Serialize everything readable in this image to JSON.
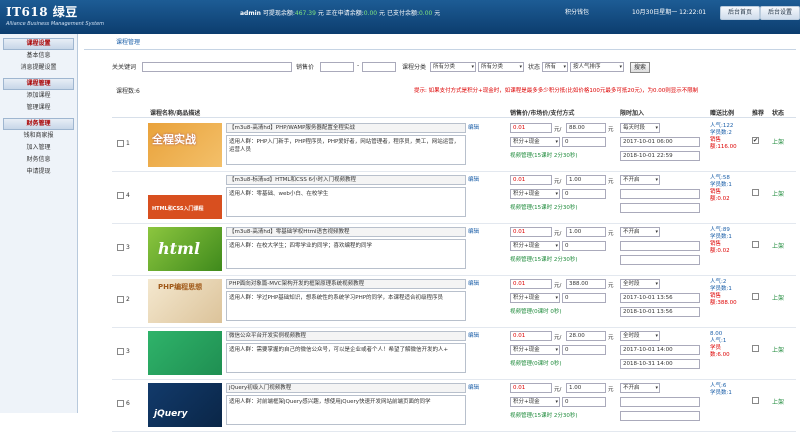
{
  "header": {
    "logo": "IT618 绿豆",
    "logo_sub": "Alliance Business Management System",
    "admin": "admin",
    "s1": "可提现余额:",
    "v1": "467.39",
    "s2": "元 正在申请余额:",
    "v2": "0.00",
    "s3": "元 已支付余额:",
    "v3": "0.00",
    "s4": "元",
    "link1": "积分钱包",
    "date": "10月30日星期一 12:22:01",
    "buttons": [
      "后台首页",
      "后台设置",
      "后台帮助",
      "退出"
    ]
  },
  "sidebar": {
    "sections": [
      {
        "title": "课程设置",
        "items": [
          "基本信息",
          "消息提醒设置"
        ]
      },
      {
        "title": "课程管理",
        "items": [
          "添加课程",
          "管理课程"
        ]
      },
      {
        "title": "财务管理",
        "items": [
          "钱和商家报",
          "加入管理",
          "财务信息",
          "申请提现"
        ]
      }
    ]
  },
  "main": {
    "crumb": "课程管理",
    "filter": {
      "kw_label": "关关键词",
      "price_label": "销售价",
      "dash": "-",
      "cat_label": "课程分类",
      "cat1": "所有分类",
      "cat2": "所有分类",
      "state_label": "状态",
      "state": "所有",
      "sort": "按人气排序",
      "btn": "搜索"
    },
    "count": "课程数:6",
    "tip": "提示: 如果支付方式是积分+现金时，如课程是最多多少积分抵(比如价格100元最多可抵20元)，为0.00则显示不限制",
    "headers": [
      "课程名称/商品描述",
      "销售价/市场价/支付方式",
      "限时加入",
      "赠送比例",
      "推荐",
      "状态"
    ],
    "rows": [
      {
        "num": "1",
        "thumb": "全程实战",
        "title": "【m3u8-高清hd】PHP/WAMP服务器配置全程实战",
        "desc": "适用人群：PHP入门新手，PHP程序员，PHP爱好者，网站管理者，程序员，美工，网站运营，运营人员",
        "edit": "编辑",
        "price": "0.01",
        "mkt": "88.00",
        "pay": "积分+现金",
        "paynum": "0",
        "note": "视频管理(15课时 2分30秒)",
        "lt": "每天时段",
        "d1": "2017-10-01 06:00",
        "d2": "2018-10-01 22:59",
        "r1": "人气:122",
        "r2": "学员数:2",
        "r3": "销售额:116.00",
        "rec": "✔",
        "status": "上架"
      },
      {
        "num": "4",
        "thumb": "HTML和CSS入门课程",
        "title": "【m3u8-标清sd】HTML和CSS 6小时入门视频教程",
        "desc": "适用人群：零基础、web小白、在校学生",
        "edit": "编辑",
        "price": "0.01",
        "mkt": "1.00",
        "pay": "积分+现金",
        "paynum": "0",
        "note": "视频管理(15课时 2分30秒)",
        "lt": "不开启",
        "d1": "",
        "d2": "",
        "r1": "人气:58",
        "r2": "学员数:1",
        "r3": "销售额:0.02",
        "rec": "",
        "status": "上架"
      },
      {
        "num": "3",
        "thumb": "html",
        "title": "【m3u8-高清hd】零基础学权Html语言视频教程",
        "desc": "适用人群：在校大学生；四零学业的同学；喜欢编程的同学",
        "edit": "编辑",
        "price": "0.01",
        "mkt": "1.00",
        "pay": "积分+现金",
        "paynum": "0",
        "note": "视频管理(15课时 2分30秒)",
        "lt": "不开启",
        "d1": "",
        "d2": "",
        "r1": "人气:89",
        "r2": "学员数:1",
        "r3": "销售额:0.02",
        "rec": "",
        "status": "上架"
      },
      {
        "num": "2",
        "thumb": "PHP编程思想",
        "title": "PHP面向对象篇-MVC架构开发的框架原理系统视频教程",
        "desc": "适用人群：学过PHP基础知识，想系统性的系统学习PHP的同学，本课程适合初级程序员",
        "edit": "编辑",
        "price": "0.01",
        "mkt": "388.00",
        "pay": "积分+现金",
        "paynum": "0",
        "note": "视频管理(0课时 0秒)",
        "lt": "全时段",
        "d1": "2017-10-01 13:56",
        "d2": "2018-10-01 13:56",
        "r1": "人气:2",
        "r2": "学员数:1",
        "r3": "销售额:388.00",
        "rec": "",
        "status": "上架"
      },
      {
        "num": "3",
        "thumb": "",
        "title": "微信公众平台开发实例视频教程",
        "desc": "适用人群：需要掌握的自己的微信公众号，可以是企业或者个人！希望了解微信开发的人+",
        "edit": "编辑",
        "price": "0.01",
        "mkt": "28.00",
        "pay": "积分+现金",
        "paynum": "0",
        "note": "视频管理(0课时 0秒)",
        "lt": "全时段",
        "d1": "2017-10-01 14:00",
        "d2": "2018-10-31 14:00",
        "r1": "8.00",
        "r2": "人气:1",
        "r3": "学员数:6.00",
        "rec": "",
        "status": "上架"
      },
      {
        "num": "6",
        "thumb": "jQuery",
        "title": "jQuery初级入门视频教程",
        "desc": "适用人群：对前端框架jQuery感兴趣，想使用jQuery快速开发网站前端页面的同学",
        "edit": "编辑",
        "price": "0.01",
        "mkt": "1.00",
        "pay": "积分+现金",
        "paynum": "0",
        "note": "视频管理(15课时 2分30秒)",
        "lt": "不开启",
        "d1": "",
        "d2": "",
        "r1": "人气:6",
        "r2": "学员数:1",
        "r3": "",
        "rec": "",
        "status": "上架"
      }
    ]
  }
}
